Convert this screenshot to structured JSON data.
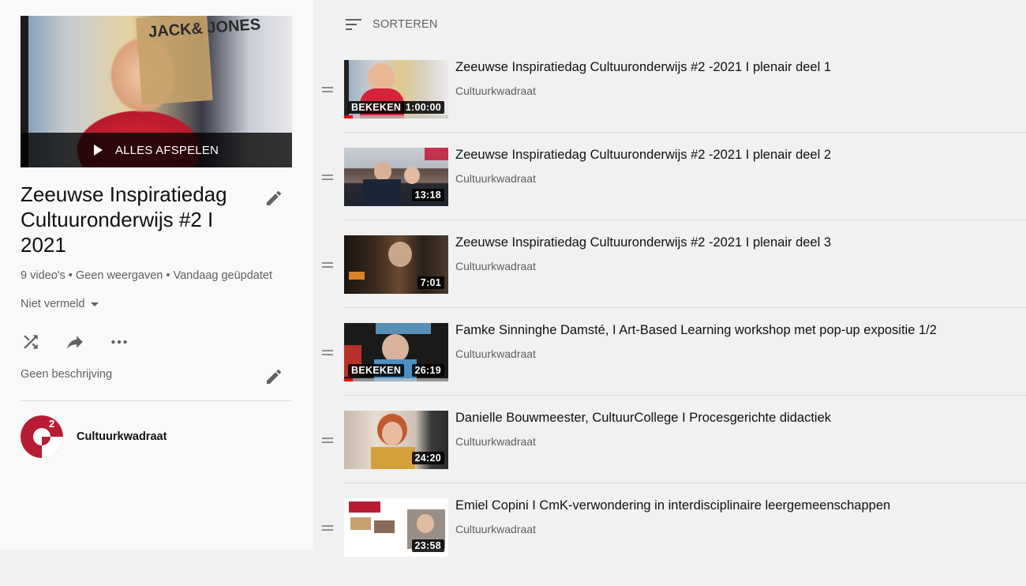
{
  "playlist": {
    "play_all_label": "ALLES AFSPELEN",
    "title": "Zeeuwse Inspiratiedag Cultuuronderwijs #2 I 2021",
    "stats": "9 video's • Geen weergaven • Vandaag geüpdatet",
    "privacy": "Niet vermeld",
    "description": "Geen beschrijving",
    "owner": "Cultuurkwadraat",
    "hero_logo_text": "JACK& JONES"
  },
  "sort": {
    "label": "SORTEREN"
  },
  "colors": {
    "brand_red": "#b81c34",
    "accent_red": "#ff0000",
    "background": "#f1f1f1"
  },
  "videos": [
    {
      "title": "Zeeuwse Inspiratiedag Cultuuronderwijs #2 -2021 I plenair deel 1",
      "channel": "Cultuurkwadraat",
      "duration": "1:00:00",
      "watched": "BEKEKEN",
      "progress": 0.08
    },
    {
      "title": "Zeeuwse Inspiratiedag Cultuuronderwijs #2 -2021 I plenair deel 2",
      "channel": "Cultuurkwadraat",
      "duration": "13:18",
      "watched": "",
      "progress": 0
    },
    {
      "title": "Zeeuwse Inspiratiedag Cultuuronderwijs #2 -2021 I plenair deel 3",
      "channel": "Cultuurkwadraat",
      "duration": "7:01",
      "watched": "",
      "progress": 0
    },
    {
      "title": "Famke Sinninghe Damsté, I Art-Based Learning workshop met pop-up expositie 1/2",
      "channel": "Cultuurkwadraat",
      "duration": "26:19",
      "watched": "BEKEKEN",
      "progress": 0.08
    },
    {
      "title": "Danielle Bouwmeester, CultuurCollege I Procesgerichte didactiek",
      "channel": "Cultuurkwadraat",
      "duration": "24:20",
      "watched": "",
      "progress": 0
    },
    {
      "title": "Emiel Copini I CmK-verwondering in interdisciplinaire leergemeenschappen",
      "channel": "Cultuurkwadraat",
      "duration": "23:58",
      "watched": "",
      "progress": 0
    }
  ]
}
